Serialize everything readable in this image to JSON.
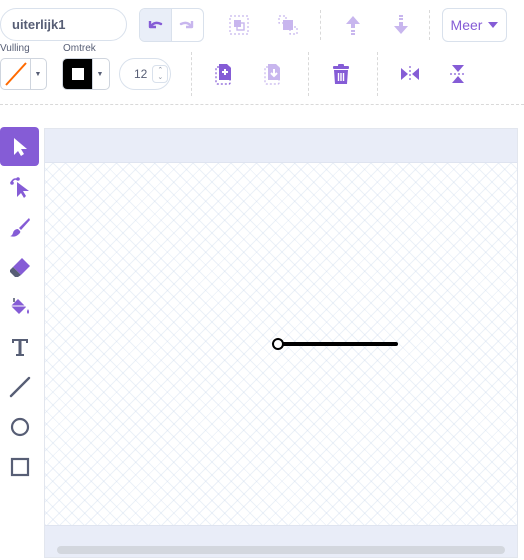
{
  "costume": {
    "name": "uiterlijk1"
  },
  "toolbar": {
    "more_label": "Meer",
    "undo_icon": "undo-icon",
    "redo_icon": "redo-icon",
    "group_icon": "group-icon",
    "ungroup_icon": "ungroup-icon",
    "forward_icon": "forward-icon",
    "backward_icon": "backward-icon"
  },
  "style_bar": {
    "fill_label": "Vulling",
    "stroke_label": "Omtrek",
    "stroke_width": "12",
    "fill_color": "none",
    "stroke_color": "#000000"
  },
  "actions": {
    "copy_icon": "copy-icon",
    "paste_icon": "paste-icon",
    "delete_icon": "trash-icon",
    "flip_horizontal_icon": "flip-horizontal-icon",
    "flip_vertical_icon": "flip-vertical-icon"
  },
  "tools": [
    {
      "name": "select",
      "icon": "select-arrow-icon",
      "active": true
    },
    {
      "name": "reshape",
      "icon": "reshape-icon",
      "active": false
    },
    {
      "name": "brush",
      "icon": "brush-icon",
      "active": false
    },
    {
      "name": "eraser",
      "icon": "eraser-icon",
      "active": false
    },
    {
      "name": "fill",
      "icon": "fill-bucket-icon",
      "active": false
    },
    {
      "name": "text",
      "icon": "text-icon",
      "active": false
    },
    {
      "name": "line",
      "icon": "line-icon",
      "active": false
    },
    {
      "name": "circle",
      "icon": "circle-icon",
      "active": false
    },
    {
      "name": "rectangle",
      "icon": "rectangle-icon",
      "active": false
    }
  ],
  "colors": {
    "accent": "#855cd6",
    "text": "#575e75",
    "fill_none_slash": "#ff6a00"
  }
}
